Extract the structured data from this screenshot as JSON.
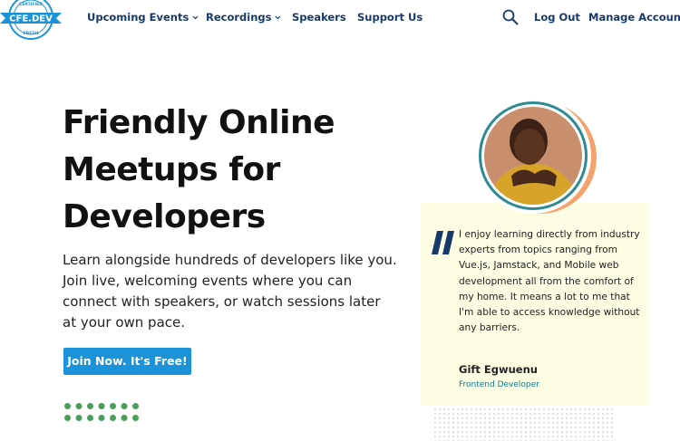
{
  "logo": {
    "text": "CFE.DEV",
    "ring_top": "CERTIFIED",
    "ring_bottom": "FRESH"
  },
  "nav": {
    "items": [
      {
        "label": "Upcoming Events",
        "has_dropdown": true
      },
      {
        "label": "Recordings",
        "has_dropdown": true
      },
      {
        "label": "Speakers",
        "has_dropdown": false
      },
      {
        "label": "Support Us",
        "has_dropdown": false
      }
    ],
    "search_icon": "search-icon",
    "logout_label": "Log Out",
    "manage_account_label": "Manage Account"
  },
  "hero": {
    "title": "Friendly Online Meetups for Developers",
    "description": "Learn alongside hundreds of developers like you. Join live, welcoming events where you can connect with speakers, or watch sessions later at your own pace.",
    "cta_label": "Join Now. It's Free!"
  },
  "testimonial": {
    "quote": "I enjoy learning directly from industry experts from topics ranging from Vue.js, Jamstack, and Mobile web development all from the comfort of my home. It means a lot to me that I'm able to access knowledge without any barriers.",
    "name": "Gift Egwuenu",
    "role": "Frontend Developer"
  },
  "colors": {
    "nav_text": "#173a6b",
    "cta_background": "#1c93d8",
    "card_background": "#fdfde4",
    "quote_mark": "#173a6b",
    "role_text": "#157a88",
    "dots": "#4a9e5c",
    "avatar_ring": "#2f8a94",
    "avatar_shadow": "#f4a36c"
  }
}
